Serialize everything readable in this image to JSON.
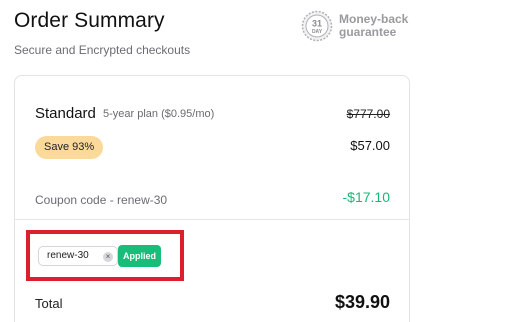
{
  "header": {
    "title": "Order Summary",
    "subtitle": "Secure and Encrypted checkouts"
  },
  "guarantee": {
    "seal_number": "31",
    "seal_word": "DAY",
    "line1": "Money-back",
    "line2": "guarantee"
  },
  "plan": {
    "name": "Standard",
    "subtitle": "5-year plan ($0.95/mo)",
    "original_price": "$777.00",
    "discount_badge": "Save 93%",
    "price": "$57.00"
  },
  "coupon": {
    "label": "Coupon code - renew-30",
    "discount": "-$17.10",
    "input_value": "renew-30",
    "clear_symbol": "×",
    "status_label": "Applied"
  },
  "total": {
    "label": "Total",
    "value": "$39.90"
  },
  "colors": {
    "accent_green": "#18bd7a",
    "discount_green": "#17b877",
    "save_badge_bg": "#fbd99a",
    "highlight_red": "#d9202c"
  },
  "icons": {
    "seal": "money-back-seal-icon",
    "clear": "close-icon"
  }
}
